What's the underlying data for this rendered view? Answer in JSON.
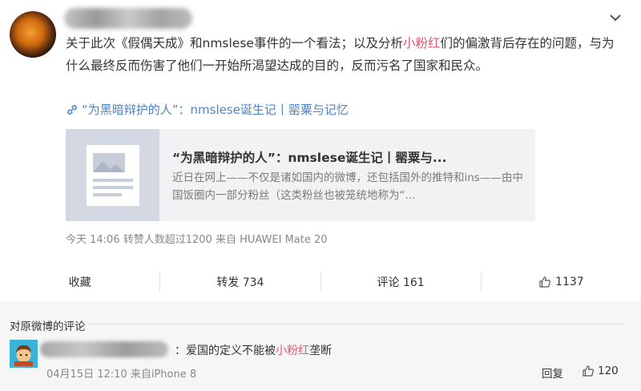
{
  "post": {
    "text_before": "关于此次《假偶天成》和nmslese事件的一个看法；以及分析",
    "text_hl": "小粉红",
    "text_after": "们的偏激背后存在的问题，与为什么最终反而伤害了他们一开始所渴望达成的目的，反而污名了国家和民众。",
    "link_text": "“为黑暗辩护的人”：nmslese诞生记丨罂粟与记忆",
    "card_title": "“为黑暗辩护的人”：nmslese诞生记丨罂粟与...",
    "card_desc": "近日在网上——不仅是诸如国内的微博，还包括国外的推特和ins——由中国饭圈内一部分粉丝（这类粉丝也被笼统地称为“...",
    "meta": "今天 14:06 转赞人数超过1200   来自 HUAWEI Mate 20"
  },
  "actions": {
    "collect": "收藏",
    "repost": "转发 734",
    "comment": "评论 161",
    "like": "1137"
  },
  "comments_section": {
    "title": "对原微博的评论",
    "items": [
      {
        "text_prefix": "：爱国的定义不能被",
        "text_hl": "小粉红",
        "text_suffix": "垄断",
        "meta": "04月15日 12:10 来自iPhone 8",
        "reply": "回复",
        "likes": "120"
      }
    ]
  },
  "colors": {
    "highlight": "#e5556b",
    "link": "#5083c2"
  },
  "icons": [
    "chevron-down-icon",
    "link-icon",
    "article-thumbnail-icon",
    "thumbs-up-icon",
    "comment-avatar-icon"
  ]
}
